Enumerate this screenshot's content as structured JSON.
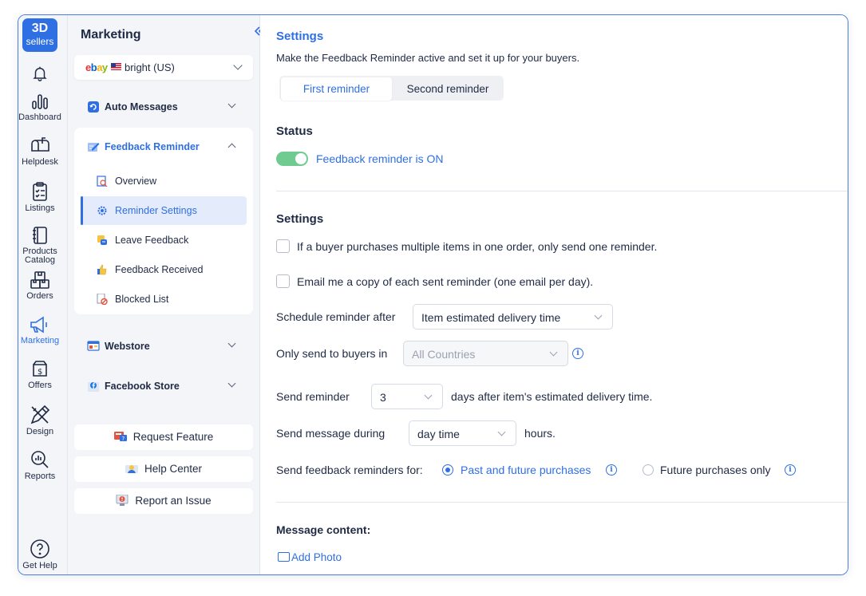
{
  "logo": {
    "line1": "3D",
    "line2": "sellers"
  },
  "rail": [
    {
      "label": "",
      "icon": "bell-icon"
    },
    {
      "label": "Dashboard",
      "icon": "bar-chart-icon"
    },
    {
      "label": "Helpdesk",
      "icon": "mailbox-icon"
    },
    {
      "label": "Listings",
      "icon": "clipboard-icon"
    },
    {
      "label": "Products Catalog",
      "icon": "book-icon"
    },
    {
      "label": "Orders",
      "icon": "boxes-icon"
    },
    {
      "label": "Marketing",
      "icon": "megaphone-icon"
    },
    {
      "label": "Offers",
      "icon": "price-tag-icon"
    },
    {
      "label": "Design",
      "icon": "pen-ruler-icon"
    },
    {
      "label": "Reports",
      "icon": "magnifier-chart-icon"
    },
    {
      "label": "Get Help",
      "icon": "question-icon"
    }
  ],
  "sidebar": {
    "title": "Marketing",
    "store": {
      "brand": "ebay",
      "name": "bright (US)"
    },
    "groups": [
      {
        "label": "Auto Messages"
      },
      {
        "label": "Feedback Reminder"
      },
      {
        "label": "Webstore"
      },
      {
        "label": "Facebook Store"
      }
    ],
    "sub_items": [
      {
        "label": "Overview"
      },
      {
        "label": "Reminder Settings"
      },
      {
        "label": "Leave Feedback"
      },
      {
        "label": "Feedback Received"
      },
      {
        "label": "Blocked List"
      }
    ],
    "buttons": [
      {
        "label": "Request Feature"
      },
      {
        "label": "Help Center"
      },
      {
        "label": "Report an Issue"
      }
    ]
  },
  "main": {
    "title": "Settings",
    "description": "Make the Feedback Reminder active and set it up for your buyers.",
    "tabs": [
      {
        "label": "First reminder"
      },
      {
        "label": "Second reminder"
      }
    ],
    "status": {
      "heading": "Status",
      "toggle_label": "Feedback reminder is ON"
    },
    "settings": {
      "heading": "Settings",
      "checkbox_one_reminder": "If a buyer purchases multiple items in one order, only send one reminder.",
      "checkbox_email_copy": "Email me a copy of each sent reminder (one email per day).",
      "schedule_label": "Schedule reminder after",
      "schedule_value": "Item estimated delivery time",
      "buyers_label": "Only send to buyers in",
      "buyers_value": "All Countries",
      "send_label": "Send reminder",
      "send_value": "3",
      "send_suffix": "days after item's estimated delivery time.",
      "during_label": "Send message during",
      "during_value": "day time",
      "during_suffix": "hours.",
      "for_label": "Send feedback reminders for:",
      "option_past_future": "Past and future purchases",
      "option_future": "Future purchases only"
    },
    "message": {
      "heading": "Message content:",
      "add_photo": "Add Photo"
    }
  },
  "colors": {
    "accent": "#2f6fe4",
    "toggle_on": "#6fcb8f"
  }
}
